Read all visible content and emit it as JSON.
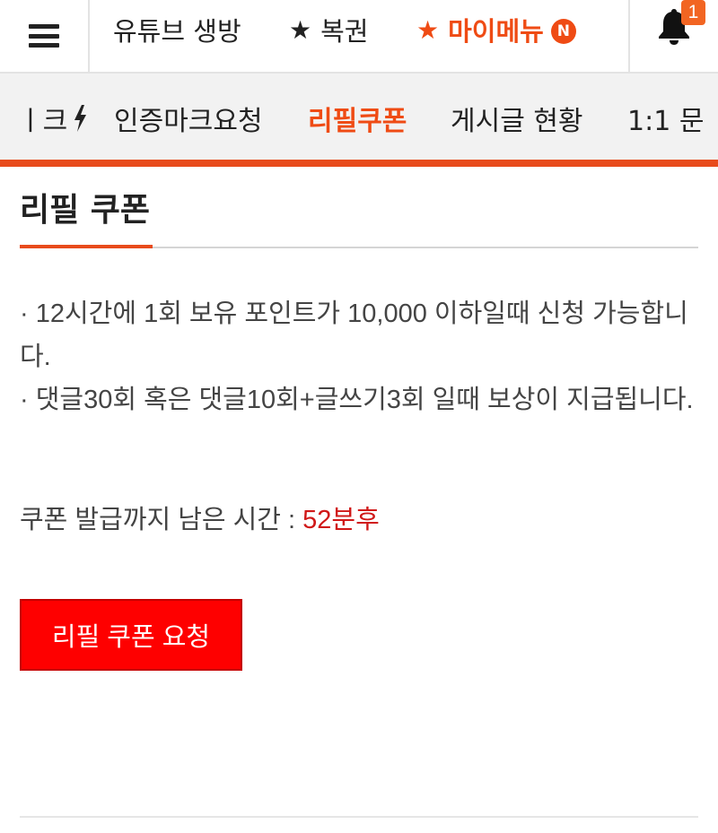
{
  "topnav": {
    "items": [
      {
        "label": "유튜브 생방",
        "prefix": ""
      },
      {
        "label": "복권",
        "prefix": "★"
      },
      {
        "label": "마이메뉴",
        "prefix": "★",
        "badge": "N"
      }
    ],
    "notification_count": "1"
  },
  "subnav": {
    "items": [
      {
        "label": "ㅣ크"
      },
      {
        "label": "인증마크요청"
      },
      {
        "label": "리필쿠폰",
        "active": true
      },
      {
        "label": "게시글 현황"
      },
      {
        "label": "1:1 문"
      }
    ]
  },
  "page": {
    "title": "리필 쿠폰",
    "notice_lines": [
      "· 12시간에 1회 보유 포인트가 10,000 이하일때 신청 가능합니다.",
      "· 댓글30회 혹은 댓글10회+글쓰기3회 일때 보상이 지급됩니다."
    ],
    "timer_label": "쿠폰 발급까지 남은 시간 : ",
    "timer_value": "52분후",
    "request_button": "리필 쿠폰 요청"
  },
  "colors": {
    "accent": "#ef4b14",
    "button": "#fe0000",
    "timer": "#d01818"
  },
  "icons": [
    "menu-icon",
    "star-icon",
    "new-badge-icon",
    "bell-icon",
    "bolt-icon"
  ]
}
